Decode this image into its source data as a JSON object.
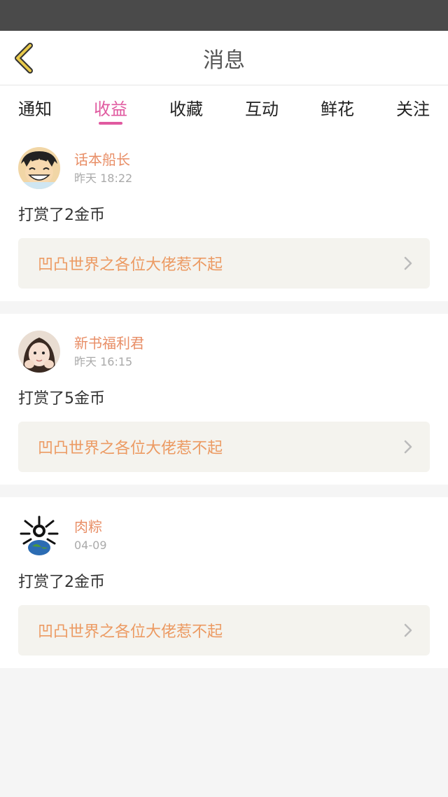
{
  "header": {
    "title": "消息"
  },
  "tabs": [
    {
      "label": "通知",
      "active": false
    },
    {
      "label": "收益",
      "active": true
    },
    {
      "label": "收藏",
      "active": false
    },
    {
      "label": "互动",
      "active": false
    },
    {
      "label": "鲜花",
      "active": false
    },
    {
      "label": "关注",
      "active": false
    }
  ],
  "items": [
    {
      "user": "话本船长",
      "time": "昨天 18:22",
      "message": "打赏了2金币",
      "book": "凹凸世界之各位大佬惹不起",
      "avatar": "cartoon-boy-avatar"
    },
    {
      "user": "新书福利君",
      "time": "昨天 16:15",
      "message": "打赏了5金币",
      "book": "凹凸世界之各位大佬惹不起",
      "avatar": "girl-photo-avatar"
    },
    {
      "user": "肉粽",
      "time": "04-09",
      "message": "打赏了2金币",
      "book": "凹凸世界之各位大佬惹不起",
      "avatar": "globe-bones-avatar"
    }
  ],
  "colors": {
    "accent": "#e05aa0",
    "username": "#e88e66",
    "book_title": "#ec9a62",
    "back_icon": "#e8c94a"
  }
}
